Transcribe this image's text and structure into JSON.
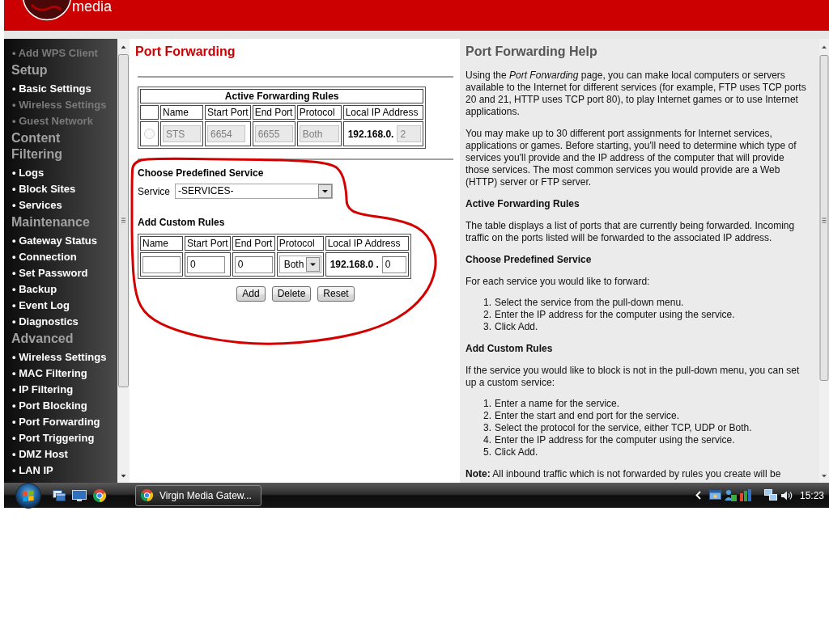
{
  "header": {
    "logo_text": "media"
  },
  "sidebar": {
    "items": [
      {
        "kind": "link",
        "label": "• Add WPS Client",
        "disabled": true
      },
      {
        "kind": "heading",
        "label": "Setup"
      },
      {
        "kind": "link",
        "label": "• Basic Settings",
        "disabled": false
      },
      {
        "kind": "link",
        "label": "• Wireless Settings",
        "disabled": true
      },
      {
        "kind": "link",
        "label": "• Guest Network",
        "disabled": true
      },
      {
        "kind": "heading",
        "label": "Content Filtering"
      },
      {
        "kind": "link",
        "label": "• Logs",
        "disabled": false
      },
      {
        "kind": "link",
        "label": "• Block Sites",
        "disabled": false
      },
      {
        "kind": "link",
        "label": "• Services",
        "disabled": false
      },
      {
        "kind": "heading",
        "label": "Maintenance"
      },
      {
        "kind": "link",
        "label": "• Gateway Status",
        "disabled": false
      },
      {
        "kind": "link",
        "label": "• Connection",
        "disabled": false
      },
      {
        "kind": "link",
        "label": "• Set Password",
        "disabled": false
      },
      {
        "kind": "link",
        "label": "• Backup",
        "disabled": false
      },
      {
        "kind": "link",
        "label": "• Event Log",
        "disabled": false
      },
      {
        "kind": "link",
        "label": "• Diagnostics",
        "disabled": false
      },
      {
        "kind": "heading",
        "label": "Advanced"
      },
      {
        "kind": "link",
        "label": "• Wireless Settings",
        "disabled": false
      },
      {
        "kind": "link",
        "label": "• MAC Filtering",
        "disabled": false
      },
      {
        "kind": "link",
        "label": "• IP Filtering",
        "disabled": false
      },
      {
        "kind": "link",
        "label": "• Port Blocking",
        "disabled": false
      },
      {
        "kind": "link",
        "label": "• Port Forwarding",
        "disabled": false
      },
      {
        "kind": "link",
        "label": "• Port Triggering",
        "disabled": false
      },
      {
        "kind": "link",
        "label": "• DMZ Host",
        "disabled": false
      },
      {
        "kind": "link",
        "label": "• LAN IP",
        "disabled": false
      }
    ]
  },
  "main": {
    "title": "Port Forwarding",
    "active_rules": {
      "title": "Active Forwarding Rules",
      "columns": [
        "Name",
        "Start Port",
        "End Port",
        "Protocol",
        "Local IP Address"
      ],
      "rows": [
        {
          "selected": false,
          "disabled": true,
          "name": "STS",
          "start_port": "6654",
          "end_port": "6655",
          "protocol": "Both",
          "ip_prefix": "192.168.0.",
          "ip_last": "2"
        }
      ]
    },
    "predefined": {
      "title": "Choose Predefined Service",
      "label": "Service",
      "value": "-SERVICES-"
    },
    "custom": {
      "title": "Add Custom Rules",
      "columns": [
        "Name",
        "Start Port",
        "End Port",
        "Protocol",
        "Local IP Address"
      ],
      "row": {
        "start_port": "0",
        "end_port": "0",
        "protocol": "Both",
        "ip_prefix": "192.168.0 .",
        "ip_last": "0"
      }
    },
    "buttons": [
      "Add",
      "Delete",
      "Reset"
    ]
  },
  "help": {
    "title": "Port Forwarding Help",
    "blocks": [
      {
        "kind": "paragraph",
        "text": "Using the *Port Forwarding* page, you can make local computers or servers available to the Internet for different services (for example, FTP uses TCP ports 20 and 21, HTTP uses TCP port 80), to play Internet games or to use Internet applications."
      },
      {
        "kind": "paragraph",
        "text": "You may make up to 30 different port assignments for Internet services, applications or games. Before starting, you'll need to determine which type of services you'll provide and the IP address of the computer that will provide those services. The most common services you would provide are a Web (HTTP) server or FTP server."
      },
      {
        "kind": "heading",
        "text": "Active Forwarding Rules"
      },
      {
        "kind": "paragraph",
        "text": "The table displays a list of ports that are currently being forwarded. Incoming traffic on the ports listed will be forwarded to the associated IP address."
      },
      {
        "kind": "heading",
        "text": "Choose Predefined Service"
      },
      {
        "kind": "paragraph",
        "text": "For each service you would like to forward:"
      },
      {
        "kind": "list",
        "items": [
          {
            "number": "1.",
            "text": "Select the service from the pull-down menu."
          },
          {
            "number": "2.",
            "text": "Enter the IP address for the computer using the service."
          },
          {
            "number": "3.",
            "text": "Click Add."
          }
        ]
      },
      {
        "kind": "heading",
        "text": "Add Custom Rules"
      },
      {
        "kind": "paragraph",
        "text": "If the service you would like to block is not in the pull-down menu, you can set up a custom service:"
      },
      {
        "kind": "list",
        "items": [
          {
            "number": "1.",
            "text": "Enter a name for the service."
          },
          {
            "number": "2.",
            "text": "Enter the start and end port for the service."
          },
          {
            "number": "3.",
            "text": "Select the protocol for the service, either TCP, UDP or Both."
          },
          {
            "number": "4.",
            "text": "Enter the IP address for the computer using the service."
          },
          {
            "number": "5.",
            "text": "Click Add."
          }
        ]
      },
      {
        "kind": "paragraph",
        "text": "**Note:** All inbound traffic which is not forwarded by rules you create will be"
      }
    ]
  },
  "taskbar": {
    "task": "Virgin Media Gatew...",
    "clock": "15:23"
  }
}
